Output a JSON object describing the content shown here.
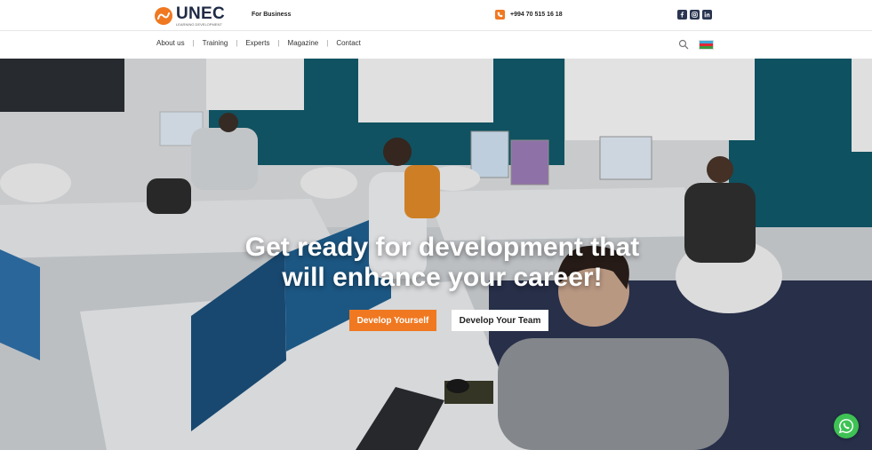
{
  "header": {
    "logo_text": "UNEC",
    "logo_subtitle": "LEARNING DEVELOPMENT",
    "for_business": "For Business",
    "phone": "+994 70 515 16 18",
    "socials": [
      "facebook-icon",
      "instagram-icon",
      "linkedin-icon"
    ]
  },
  "nav": {
    "items": [
      "About us",
      "Training",
      "Experts",
      "Magazine",
      "Contact"
    ],
    "separator": "|"
  },
  "hero": {
    "title_line1": "Get ready for development that",
    "title_line2": "will enhance your career!",
    "primary_button": "Develop Yourself",
    "secondary_button": "Develop Your Team"
  },
  "colors": {
    "accent": "#f07820",
    "dark": "#1f2a44",
    "whatsapp": "#3ec254",
    "teal_wall": "#12596a"
  }
}
